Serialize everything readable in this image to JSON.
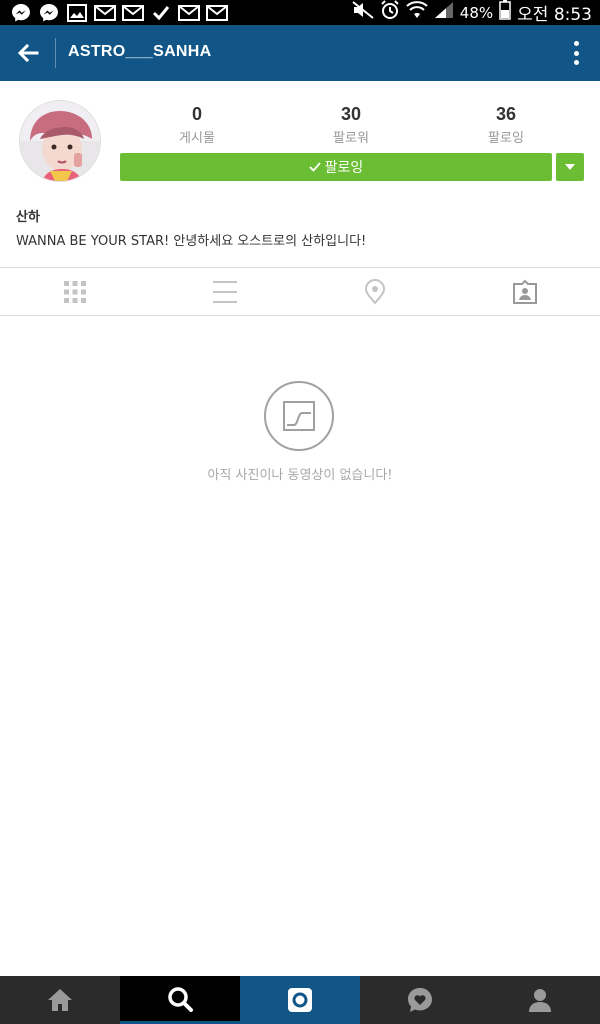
{
  "status_bar": {
    "battery_percent": "48%",
    "time": "오전 8:53",
    "notification_icons": [
      "messenger-icon",
      "messenger-icon",
      "image-icon",
      "mail-icon",
      "mail-icon",
      "check-icon",
      "mail-icon",
      "mail-icon"
    ],
    "status_icons": [
      "mute-icon",
      "alarm-icon",
      "wifi-icon",
      "signal-icon",
      "battery-icon"
    ]
  },
  "app_bar": {
    "title": "ASTRO___SANHA",
    "background_color": "#125688"
  },
  "profile": {
    "stats": [
      {
        "count": "0",
        "label": "게시물"
      },
      {
        "count": "30",
        "label": "팔로워"
      },
      {
        "count": "36",
        "label": "팔로잉"
      }
    ],
    "follow_button_label": "팔로잉",
    "follow_button_color": "#6bbd33",
    "name": "산하",
    "bio": "WANNA BE YOUR STAR! 안녕하세요 오스트로의 산하입니다!"
  },
  "tabs": [
    {
      "icon": "grid-icon"
    },
    {
      "icon": "list-icon"
    },
    {
      "icon": "location-pin-icon"
    },
    {
      "icon": "tagged-photos-icon"
    }
  ],
  "empty_state": {
    "icon": "photo-placeholder-icon",
    "message": "아직 사진이나 동영상이 없습니다!"
  },
  "bottom_nav": {
    "items": [
      {
        "icon": "home-icon"
      },
      {
        "icon": "search-icon",
        "active": true
      },
      {
        "icon": "camera-icon"
      },
      {
        "icon": "activity-heart-icon"
      },
      {
        "icon": "profile-icon"
      }
    ]
  }
}
